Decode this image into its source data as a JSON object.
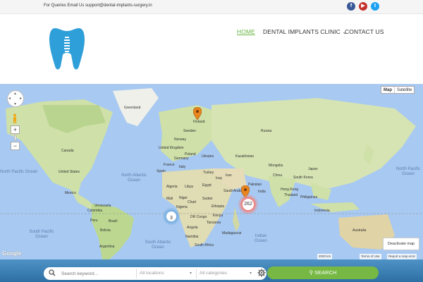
{
  "topbar": {
    "query": "For Queries Email Us support@dental-implants-surgery.in",
    "social": [
      "facebook-icon",
      "youtube-icon",
      "twitter-icon"
    ]
  },
  "header": {
    "logo": "tooth-implant-logo",
    "nav": {
      "home": "HOME",
      "clinic": "DENTAL IMPLANTS CLINIC",
      "contact": "CONTACT US"
    },
    "active_color": "#6bb544"
  },
  "map": {
    "type_map": "Map",
    "type_satellite": "Satellite",
    "zoom_in": "+",
    "zoom_out": "−",
    "labels": {
      "greenland": "Greenland",
      "finland": "Finland",
      "sweden": "Sweden",
      "norway": "Norway",
      "uk": "United Kingdom",
      "germany": "Germany",
      "poland": "Poland",
      "ukraine": "Ukraine",
      "france": "France",
      "spain": "Spain",
      "italy": "Italy",
      "turkey": "Turkey",
      "iran": "Iran",
      "iraq": "Iraq",
      "kazakhstan": "Kazakhstan",
      "russia": "Russia",
      "mongolia": "Mongolia",
      "china": "China",
      "japan": "Japan",
      "india": "India",
      "pakistan": "Pakistan",
      "thailand": "Thailand",
      "philippines": "Philippines",
      "indonesia": "Indonesia",
      "australia": "Australia",
      "canada": "Canada",
      "united_states": "United States",
      "mexico": "Mexico",
      "peru": "Peru",
      "brazil": "Brazil",
      "bolivia": "Bolivia",
      "argentina": "Argentina",
      "algeria": "Algeria",
      "libya": "Libya",
      "egypt": "Egypt",
      "mali": "Mali",
      "niger": "Niger",
      "chad": "Chad",
      "sudan": "Sudan",
      "nigeria": "Nigeria",
      "ethiopia": "Ethiopia",
      "kenya": "Kenya",
      "dr_congo": "DR Congo",
      "tanzania": "Tanzania",
      "angola": "Angola",
      "namibia": "Namibia",
      "south_africa": "South Africa",
      "madagascar": "Madagascar",
      "saudi_arabia": "Saudi Arabia",
      "hong_kong": "Hong Kong",
      "south_korea": "South Korea",
      "colombia": "Colombia",
      "venezuela": "Venezuela"
    },
    "oceans": {
      "north_pacific": "North Pacific Ocean",
      "north_atlantic": "North Atlantic Ocean",
      "south_atlantic": "South Atlantic Ocean",
      "south_pacific": "South Pacific Ocean",
      "indian": "Indian Ocean",
      "north_pacific_right": "North Pacific Ocean"
    },
    "clusters": {
      "blue": "3",
      "red": "262"
    },
    "deactivate": "Deactivate map",
    "google": "Google",
    "scale": "2000 km",
    "terms": "Terms of Use",
    "report": "Report a map error"
  },
  "search": {
    "keyword_placeholder": "Search keyword...",
    "locations": "All locations",
    "categories": "All categories",
    "button": "SEARCH",
    "button_color": "#76b843"
  }
}
